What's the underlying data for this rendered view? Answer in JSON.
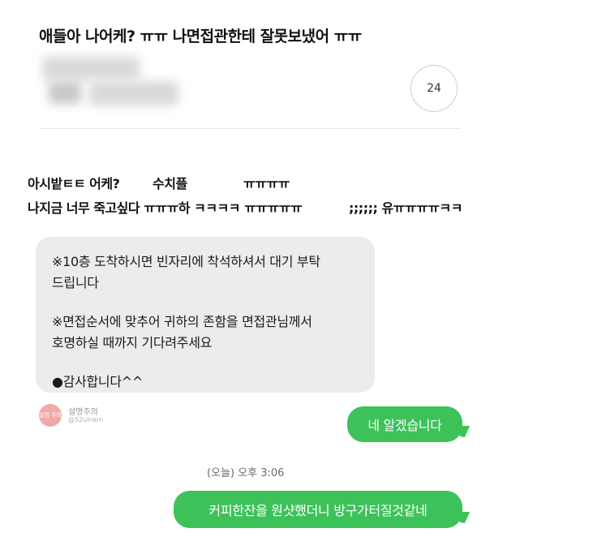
{
  "post": {
    "title": "애들아 나어케? ㅠㅠ 나면접관한테 잘못보냈어 ㅠㅠ",
    "comment_count": "24",
    "line1_a": "아시밭ㅌㅌ 어케?",
    "line1_b": "수치플",
    "line1_c": "ㅠㅠㅠㅠ",
    "line2_a": "나지금 너무 죽고싶다 ㅠㅠㅠ하 ㅋㅋㅋㅋ ㅠㅠㅠㅠㅠ",
    "line2_b": ";;;;;; 유ㅠㅠㅠㅠㅋㅋ"
  },
  "chat": {
    "received": {
      "line1": "※10층 도착하시면 빈자리에 착석하셔서 대기 부탁",
      "line2": "드립니다",
      "line3": "※면접순서에 맞추어 귀하의 존함을 면접관님께서",
      "line4": "호명하실 때까지 기다려주세요",
      "line5": "●감사합니다^^"
    },
    "watermark": {
      "logo": "설명 주의",
      "name": "설명주의",
      "handle": "@52ulnem"
    },
    "sent_1": "네 알겠습니다",
    "time_divider": "(오늘) 오후 3:06",
    "sent_2": "커피한잔을 원샷했더니 방구가터질것같네"
  },
  "colors": {
    "sent_bubble": "#3dc25a",
    "received_bubble": "#ececed"
  }
}
